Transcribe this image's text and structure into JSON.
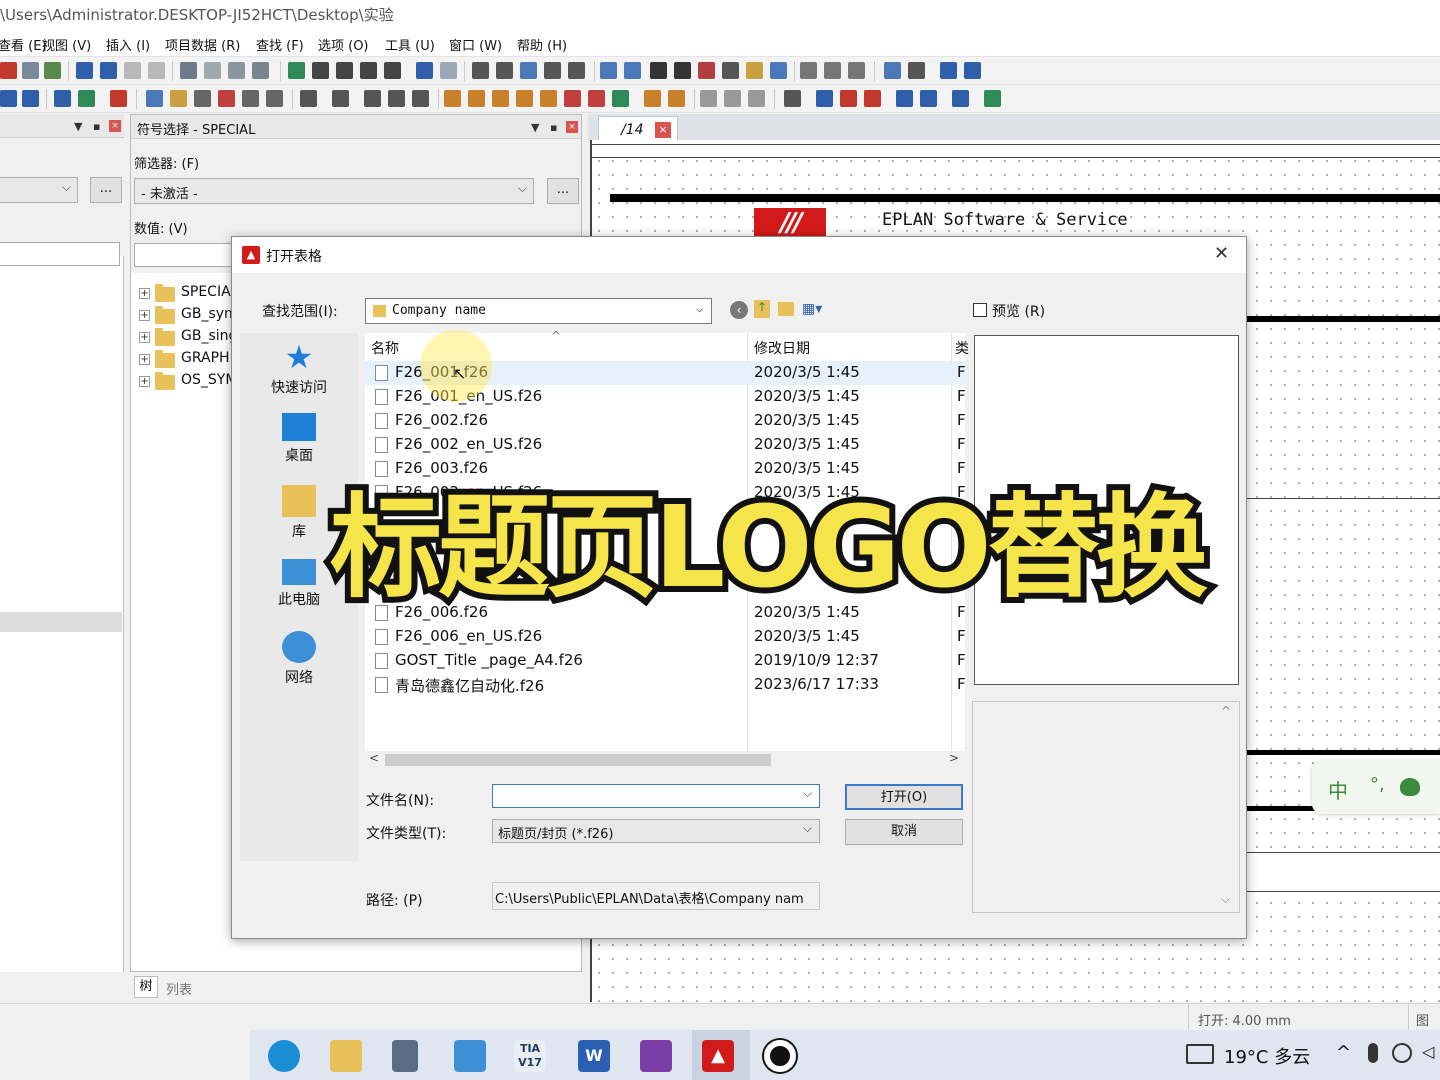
{
  "window": {
    "path": "\\Users\\Administrator.DESKTOP-JI52HCT\\Desktop\\实验"
  },
  "menu": [
    "查看 (E)",
    "视图 (V)",
    "插入 (I)",
    "项目数据 (R)",
    "查找 (F)",
    "选项 (O)",
    "工具 (U)",
    "窗口 (W)",
    "帮助 (H)"
  ],
  "symbol_panel": {
    "title": "符号选择 - SPECIAL",
    "filter_label": "筛选器: (F)",
    "filter_value": "- 未激活 -",
    "value_label": "数值: (V)",
    "more_button": "...",
    "tree": [
      "SPECIA",
      "GB_sym",
      "GB_sing",
      "GRAPH",
      "OS_SYM"
    ],
    "bottom_tabs": [
      "树",
      "列表"
    ]
  },
  "document_tab": {
    "label": "/14",
    "close": "×"
  },
  "drawing": {
    "company_text": "EPLAN Software & Service",
    "logo_text": "///"
  },
  "dialog": {
    "title": "打开表格",
    "close": "✕",
    "lookin_label": "查找范围(I):",
    "lookin_value": "Company name",
    "preview_label": "预览 (R)",
    "places": [
      {
        "label": "快速访问",
        "icon": "star-icon"
      },
      {
        "label": "桌面",
        "icon": "desktop-icon"
      },
      {
        "label": "库",
        "icon": "library-icon"
      },
      {
        "label": "此电脑",
        "icon": "computer-icon"
      },
      {
        "label": "网络",
        "icon": "network-icon"
      }
    ],
    "columns": {
      "name": "名称",
      "date": "修改日期",
      "type": "类"
    },
    "files": [
      {
        "name": "F26_001.f26",
        "date": "2020/3/5 1:45",
        "type": "F"
      },
      {
        "name": "F26_001_en_US.f26",
        "date": "2020/3/5 1:45",
        "type": "F"
      },
      {
        "name": "F26_002.f26",
        "date": "2020/3/5 1:45",
        "type": "F"
      },
      {
        "name": "F26_002_en_US.f26",
        "date": "2020/3/5 1:45",
        "type": "F"
      },
      {
        "name": "F26_003.f26",
        "date": "2020/3/5 1:45",
        "type": "F"
      },
      {
        "name": "F26_003_en_US.f26",
        "date": "2020/3/5 1:45",
        "type": "F"
      },
      {
        "name": "F26_006.f26",
        "date": "2020/3/5 1:45",
        "type": "F"
      },
      {
        "name": "F26_006_en_US.f26",
        "date": "2020/3/5 1:45",
        "type": "F"
      },
      {
        "name": "GOST_Title _page_A4.f26",
        "date": "2019/10/9 12:37",
        "type": "F"
      },
      {
        "name": "青岛德鑫亿自动化.f26",
        "date": "2023/6/17 17:33",
        "type": "F"
      }
    ],
    "filename_label": "文件名(N):",
    "filename_value": "",
    "filetype_label": "文件类型(T):",
    "filetype_value": "标题页/封页 (*.f26)",
    "path_label": "路径: (P)",
    "path_value": "C:\\Users\\Public\\EPLAN\\Data\\表格\\Company nam",
    "open_button": "打开(O)",
    "cancel_button": "取消"
  },
  "overlay": {
    "caption": "标题页LOGO替换"
  },
  "statusbar": {
    "snap": "打开: 4.00 mm",
    "right": "图用"
  },
  "ime": {
    "chinese": "中",
    "punct": "°,"
  },
  "taskbar": {
    "weather": "19°C 多云",
    "apps": [
      "edge-icon",
      "explorer-icon",
      "calculator-icon",
      "computer-icon",
      "tia-portal-icon",
      "word-icon",
      "onenote-icon",
      "eplan-icon",
      "record-icon"
    ],
    "tia_label": "TIA V17",
    "word_label": "W"
  }
}
